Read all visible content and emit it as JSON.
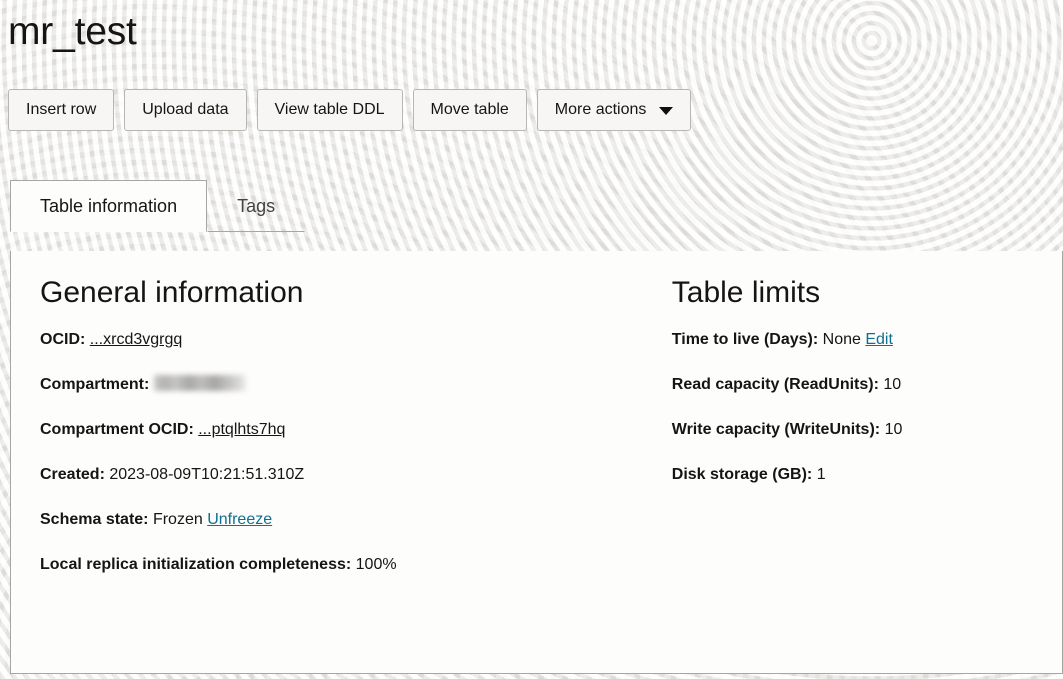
{
  "header": {
    "title": "mr_test"
  },
  "toolbar": {
    "buttons": [
      {
        "label": "Insert row",
        "name": "insert-row-button"
      },
      {
        "label": "Upload data",
        "name": "upload-data-button"
      },
      {
        "label": "View table DDL",
        "name": "view-table-ddl-button"
      },
      {
        "label": "Move table",
        "name": "move-table-button"
      },
      {
        "label": "More actions",
        "name": "more-actions-button",
        "icon": "chevron-down-icon"
      }
    ]
  },
  "tabs": [
    {
      "label": "Table information",
      "active": true
    },
    {
      "label": "Tags",
      "active": false
    }
  ],
  "general_information": {
    "heading": "General information",
    "ocid": {
      "label": "OCID:",
      "link_text": "...xrcd3vgrgq"
    },
    "compartment": {
      "label": "Compartment:",
      "value": "",
      "redacted": true
    },
    "compartment_ocid": {
      "label": "Compartment OCID:",
      "link_text": "...ptqlhts7hq"
    },
    "created": {
      "label": "Created:",
      "value": "2023-08-09T10:21:51.310Z"
    },
    "schema_state": {
      "label": "Schema state:",
      "value": "Frozen",
      "action_link": "Unfreeze"
    },
    "local_replica": {
      "label": "Local replica initialization completeness:",
      "value": "100%"
    }
  },
  "table_limits": {
    "heading": "Table limits",
    "time_to_live": {
      "label": "Time to live (Days):",
      "value": "None",
      "action_link": "Edit"
    },
    "read_capacity": {
      "label": "Read capacity (ReadUnits):",
      "value": "10"
    },
    "write_capacity": {
      "label": "Write capacity (WriteUnits):",
      "value": "10"
    },
    "disk_storage": {
      "label": "Disk storage (GB):",
      "value": "1"
    }
  },
  "colors": {
    "link_teal": "#0f6f8f",
    "text": "#161513",
    "panel_bg": "#fdfdfb",
    "page_bg": "#f1f0ee",
    "border": "#a8a6a2"
  }
}
